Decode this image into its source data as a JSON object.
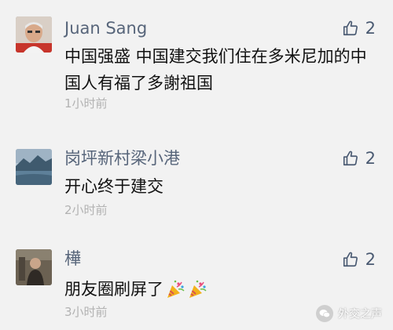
{
  "comments": [
    {
      "name": "Juan Sang",
      "likes": "2",
      "text": "中国强盛 中国建交我们住在多米尼加的中国人有福了多謝祖国",
      "time": "1小时前",
      "avatar": "avatar-elderly-man"
    },
    {
      "name": "岗坪新村梁小港",
      "likes": "2",
      "text": "开心终于建交",
      "time": "2小时前",
      "avatar": "avatar-lake-landscape"
    },
    {
      "name": "樺",
      "likes": "2",
      "text": "朋友圈刷屏了",
      "emoji": [
        "party-popper-icon",
        "party-popper-icon"
      ],
      "time": "3小时前",
      "avatar": "avatar-person-photo"
    }
  ],
  "like_icon": "thumbs-up-icon",
  "watermark": {
    "text": "外交之声",
    "icon": "wechat-icon"
  },
  "colors": {
    "background": "#f2f2f2",
    "name": "#57657a",
    "body_text": "#111111",
    "time": "#b2b2b2"
  }
}
